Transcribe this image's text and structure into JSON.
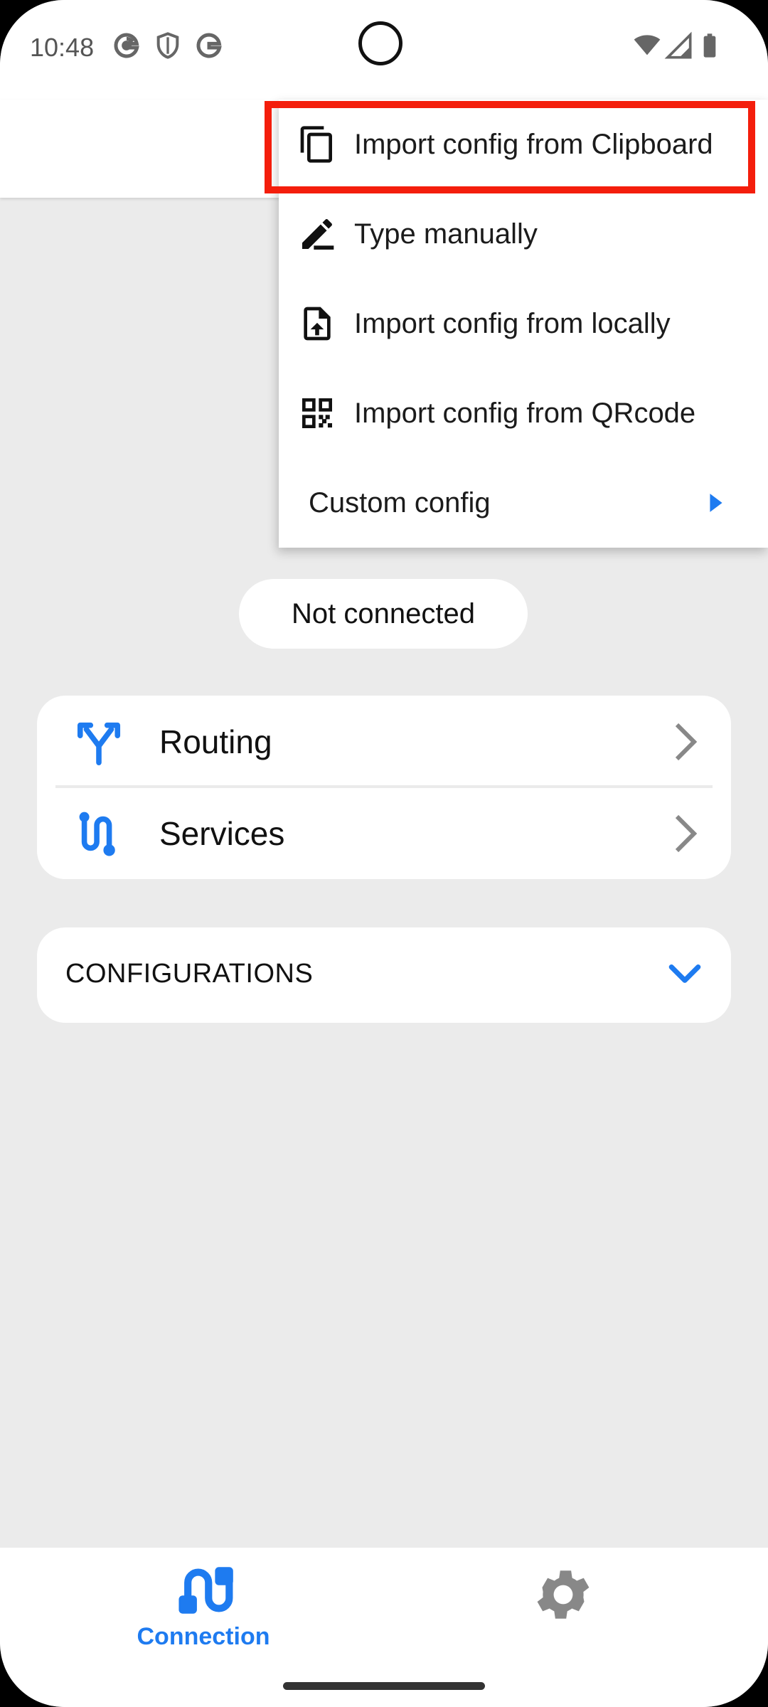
{
  "statusbar": {
    "time": "10:48",
    "left_icons": [
      "google-icon",
      "shield-icon",
      "google-icon"
    ],
    "right_icons": [
      "wifi-icon",
      "signal-icon",
      "battery-icon"
    ]
  },
  "connection_status": "Not connected",
  "nav_items": [
    {
      "label": "Routing",
      "icon": "routing-icon"
    },
    {
      "label": "Services",
      "icon": "services-icon"
    }
  ],
  "configurations": {
    "title": "CONFIGURATIONS",
    "icon": "chevron-down-icon"
  },
  "menu": {
    "items": [
      {
        "label": "Import config from Clipboard",
        "icon": "copy-icon"
      },
      {
        "label": "Type manually",
        "icon": "edit-icon"
      },
      {
        "label": "Import config from locally",
        "icon": "file-upload-icon"
      },
      {
        "label": "Import config from QRcode",
        "icon": "qrcode-icon"
      },
      {
        "label": "Custom config",
        "icon": "submenu-arrow-icon"
      }
    ],
    "highlighted_index": 0
  },
  "bottom_nav": {
    "tabs": [
      {
        "label": "Connection",
        "icon": "connection-icon",
        "active": true
      },
      {
        "label": "",
        "icon": "gear-icon",
        "active": false
      }
    ]
  },
  "colors": {
    "accent": "#1e7bf0",
    "highlight": "#f41e0c",
    "background": "#ebebeb"
  }
}
